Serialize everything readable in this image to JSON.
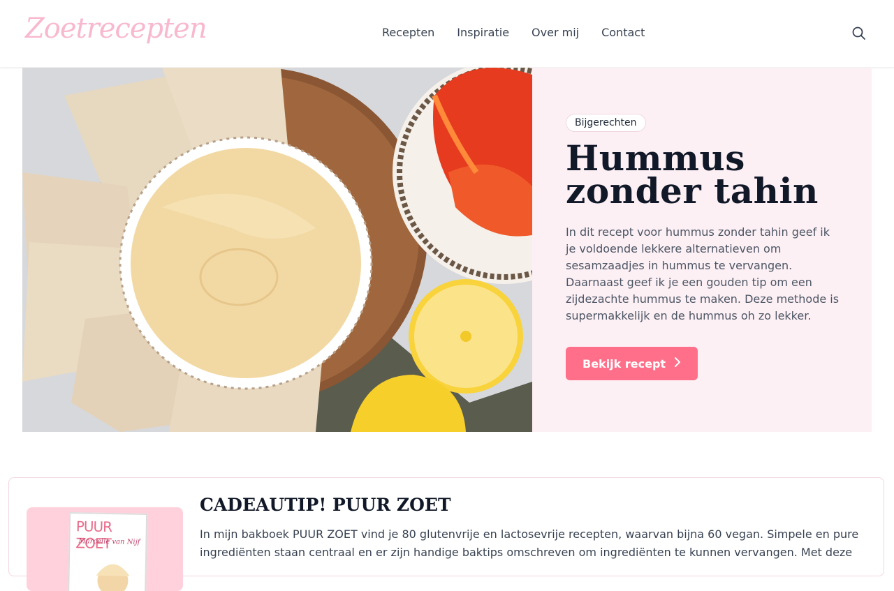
{
  "header": {
    "logo": "Zoetrecepten",
    "nav": [
      "Recepten",
      "Inspiratie",
      "Over mij",
      "Contact"
    ],
    "search_icon": "search-icon"
  },
  "hero": {
    "category": "Bijgerechten",
    "title_line1": "Hummus",
    "title_line2": "zonder tahin",
    "description": "In dit recept voor hummus zonder tahin geef ik je voldoende lekkere alternatieven om sesamzaadjes in hummus te vervangen. Daarnaast geef ik je een gouden tip om een zijdezachte hummus te maken. Deze methode is supermakkelijk en de hummus oh zo lekker.",
    "button_label": "Bekijk recept",
    "button_icon": "chevron-right-icon",
    "colors": {
      "background": "#fdf0f5",
      "button": "#ff6f8a",
      "logo": "#f8b8cf"
    }
  },
  "promo": {
    "title": "CADEAUTIP! PUUR ZOET",
    "text": "In mijn bakboek PUUR ZOET vind je 80 glutenvrije en lactosevrije recepten, waarvan bijna 60 vegan. Simpele en pure ingrediënten staan centraal en er zijn handige baktips omschreven om ingrediënten te kunnen vervangen. Met deze",
    "book_title": "PUUR ZOET",
    "book_author": "Marcelle van Nijf"
  }
}
